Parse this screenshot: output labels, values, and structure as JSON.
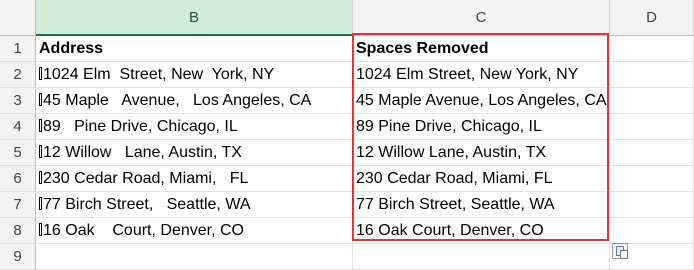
{
  "columns": [
    "B",
    "C",
    "D"
  ],
  "selected_column": "B",
  "rows": [
    "1",
    "2",
    "3",
    "4",
    "5",
    "6",
    "7",
    "8",
    "9"
  ],
  "header": {
    "b": "Address",
    "c": "Spaces Removed"
  },
  "data": [
    {
      "b": "1024 Elm  Street, New  York, NY",
      "c": "1024 Elm Street, New York, NY"
    },
    {
      "b": "45 Maple   Avenue,   Los Angeles, CA",
      "c": "45 Maple Avenue, Los Angeles, CA"
    },
    {
      "b": "89   Pine Drive, Chicago, IL",
      "c": "89 Pine Drive, Chicago, IL"
    },
    {
      "b": "12 Willow   Lane, Austin, TX",
      "c": "12 Willow Lane, Austin, TX"
    },
    {
      "b": "230 Cedar Road, Miami,   FL",
      "c": "230 Cedar Road, Miami, FL"
    },
    {
      "b": "77 Birch Street,   Seattle, WA",
      "c": "77 Birch Street, Seattle, WA"
    },
    {
      "b": "16 Oak    Court, Denver, CO",
      "c": "16 Oak Court, Denver, CO"
    }
  ],
  "icons": {
    "paste_options": "paste-options-icon",
    "nonprinting_char": "nonprinting-char-glyph"
  },
  "colors": {
    "selected_header": "#d3ecd9",
    "selected_accent": "#1e7145",
    "highlight_border": "#e0353b"
  }
}
